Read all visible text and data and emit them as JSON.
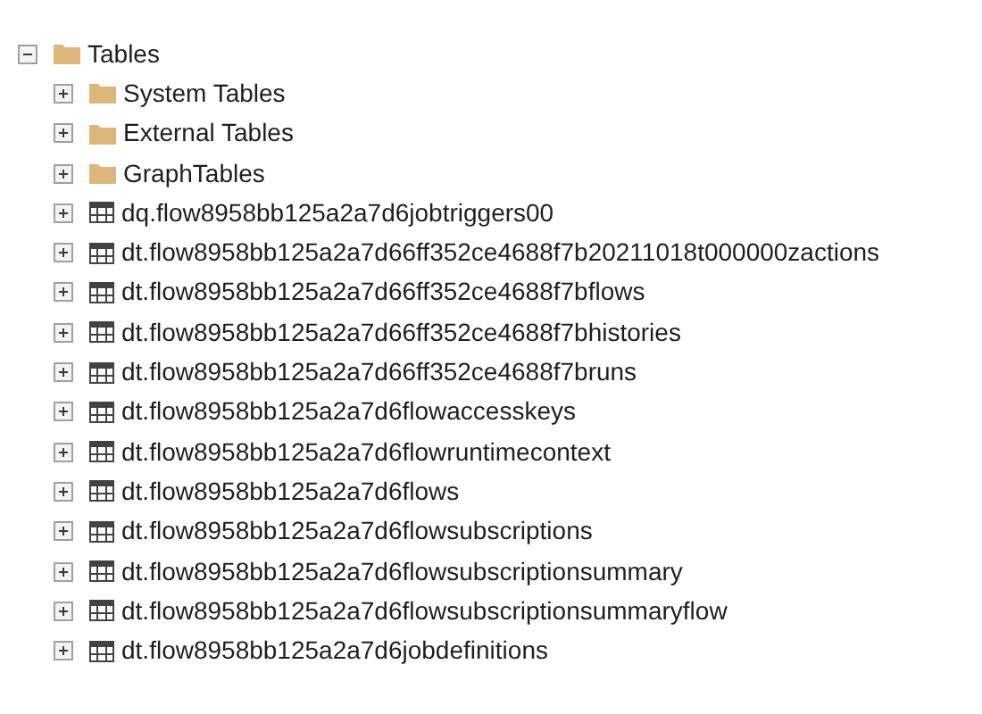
{
  "tree": {
    "label": "Tables",
    "kind": "folder",
    "expanded": true,
    "children": [
      {
        "label": "System Tables",
        "kind": "folder",
        "expanded": false
      },
      {
        "label": "External Tables",
        "kind": "folder",
        "expanded": false
      },
      {
        "label": "GraphTables",
        "kind": "folder",
        "expanded": false
      },
      {
        "label": "dq.flow8958bb125a2a7d6jobtriggers00",
        "kind": "table",
        "expanded": false
      },
      {
        "label": "dt.flow8958bb125a2a7d66ff352ce4688f7b20211018t000000zactions",
        "kind": "table",
        "expanded": false
      },
      {
        "label": "dt.flow8958bb125a2a7d66ff352ce4688f7bflows",
        "kind": "table",
        "expanded": false
      },
      {
        "label": "dt.flow8958bb125a2a7d66ff352ce4688f7bhistories",
        "kind": "table",
        "expanded": false
      },
      {
        "label": "dt.flow8958bb125a2a7d66ff352ce4688f7bruns",
        "kind": "table",
        "expanded": false
      },
      {
        "label": "dt.flow8958bb125a2a7d6flowaccesskeys",
        "kind": "table",
        "expanded": false
      },
      {
        "label": "dt.flow8958bb125a2a7d6flowruntimecontext",
        "kind": "table",
        "expanded": false
      },
      {
        "label": "dt.flow8958bb125a2a7d6flows",
        "kind": "table",
        "expanded": false
      },
      {
        "label": "dt.flow8958bb125a2a7d6flowsubscriptions",
        "kind": "table",
        "expanded": false
      },
      {
        "label": "dt.flow8958bb125a2a7d6flowsubscriptionsummary",
        "kind": "table",
        "expanded": false
      },
      {
        "label": "dt.flow8958bb125a2a7d6flowsubscriptionsummaryflow",
        "kind": "table",
        "expanded": false
      },
      {
        "label": "dt.flow8958bb125a2a7d6jobdefinitions",
        "kind": "table",
        "expanded": false
      }
    ]
  }
}
